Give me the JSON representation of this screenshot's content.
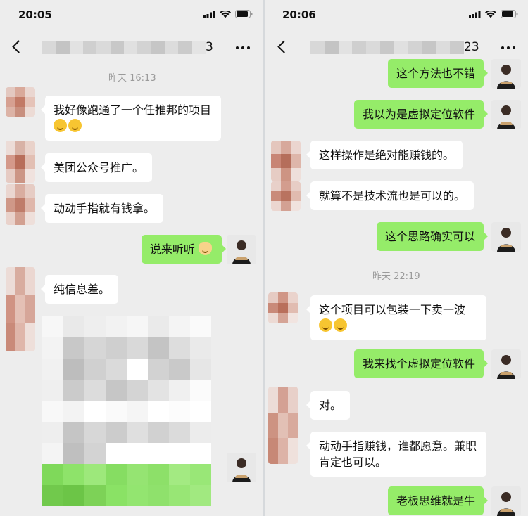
{
  "left": {
    "status_time": "20:05",
    "title_suffix": "3",
    "timestamp": "昨天 16:13",
    "messages": [
      {
        "text": "我好像跑通了一个任推邦的项目",
        "emoji": "laugh-cry x2"
      },
      {
        "text": "美团公众号推广。"
      },
      {
        "text": "动动手指就有钱拿。"
      },
      {
        "text": "说来听听",
        "emoji": "cat"
      },
      {
        "text": "纯信息差。"
      }
    ]
  },
  "right": {
    "status_time": "20:06",
    "title_suffix": "23",
    "timestamp": "昨天 22:19",
    "messages": [
      {
        "text": "这个方法也不错"
      },
      {
        "text": "我以为是虚拟定位软件"
      },
      {
        "text": "这样操作是绝对能赚钱的。"
      },
      {
        "text": "就算不是技术流也是可以的。"
      },
      {
        "text": "这个思路确实可以"
      },
      {
        "text": "这个项目可以包装一下卖一波",
        "emoji": "laugh-cry x2"
      },
      {
        "text": "我来找个虚拟定位软件"
      },
      {
        "text": "对。"
      },
      {
        "text": "动动手指赚钱，谁都愿意。兼职肯定也可以。"
      },
      {
        "text": "老板思维就是牛"
      }
    ]
  },
  "icons": {
    "back": "chevron-left-icon",
    "more": "more-dots-icon",
    "signal": "signal-icon",
    "wifi": "wifi-icon",
    "battery": "battery-icon",
    "laugh_cry": "laugh-cry-emoji",
    "cat": "cat-emoji"
  },
  "colors": {
    "background": "#ededed",
    "bubble_in": "#ffffff",
    "bubble_out": "#95ec69",
    "timestamp": "#9a9a9a"
  }
}
